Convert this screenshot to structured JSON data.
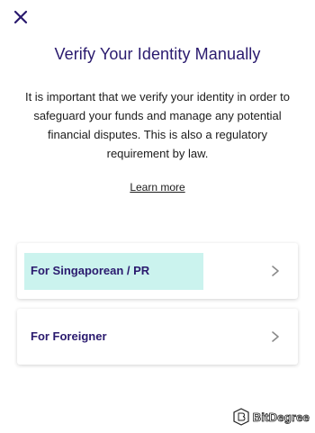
{
  "header": {
    "close_icon": "close-icon"
  },
  "title": "Verify Your Identity Manually",
  "description": "It is important that we verify your identity in order to safeguard your funds and manage any potential financial disputes. This is also a regulatory requirement by law.",
  "learn_more": "Learn more",
  "options": [
    {
      "label": "For Singaporean / PR",
      "highlighted": true,
      "icon": "chevron-right-icon"
    },
    {
      "label": "For Foreigner",
      "highlighted": false,
      "icon": "chevron-right-icon"
    }
  ],
  "watermark": {
    "text": "BitDegree"
  },
  "colors": {
    "title": "#2a1a6e",
    "highlight": "#cbf3ee",
    "chevron": "#8a8a8a"
  }
}
